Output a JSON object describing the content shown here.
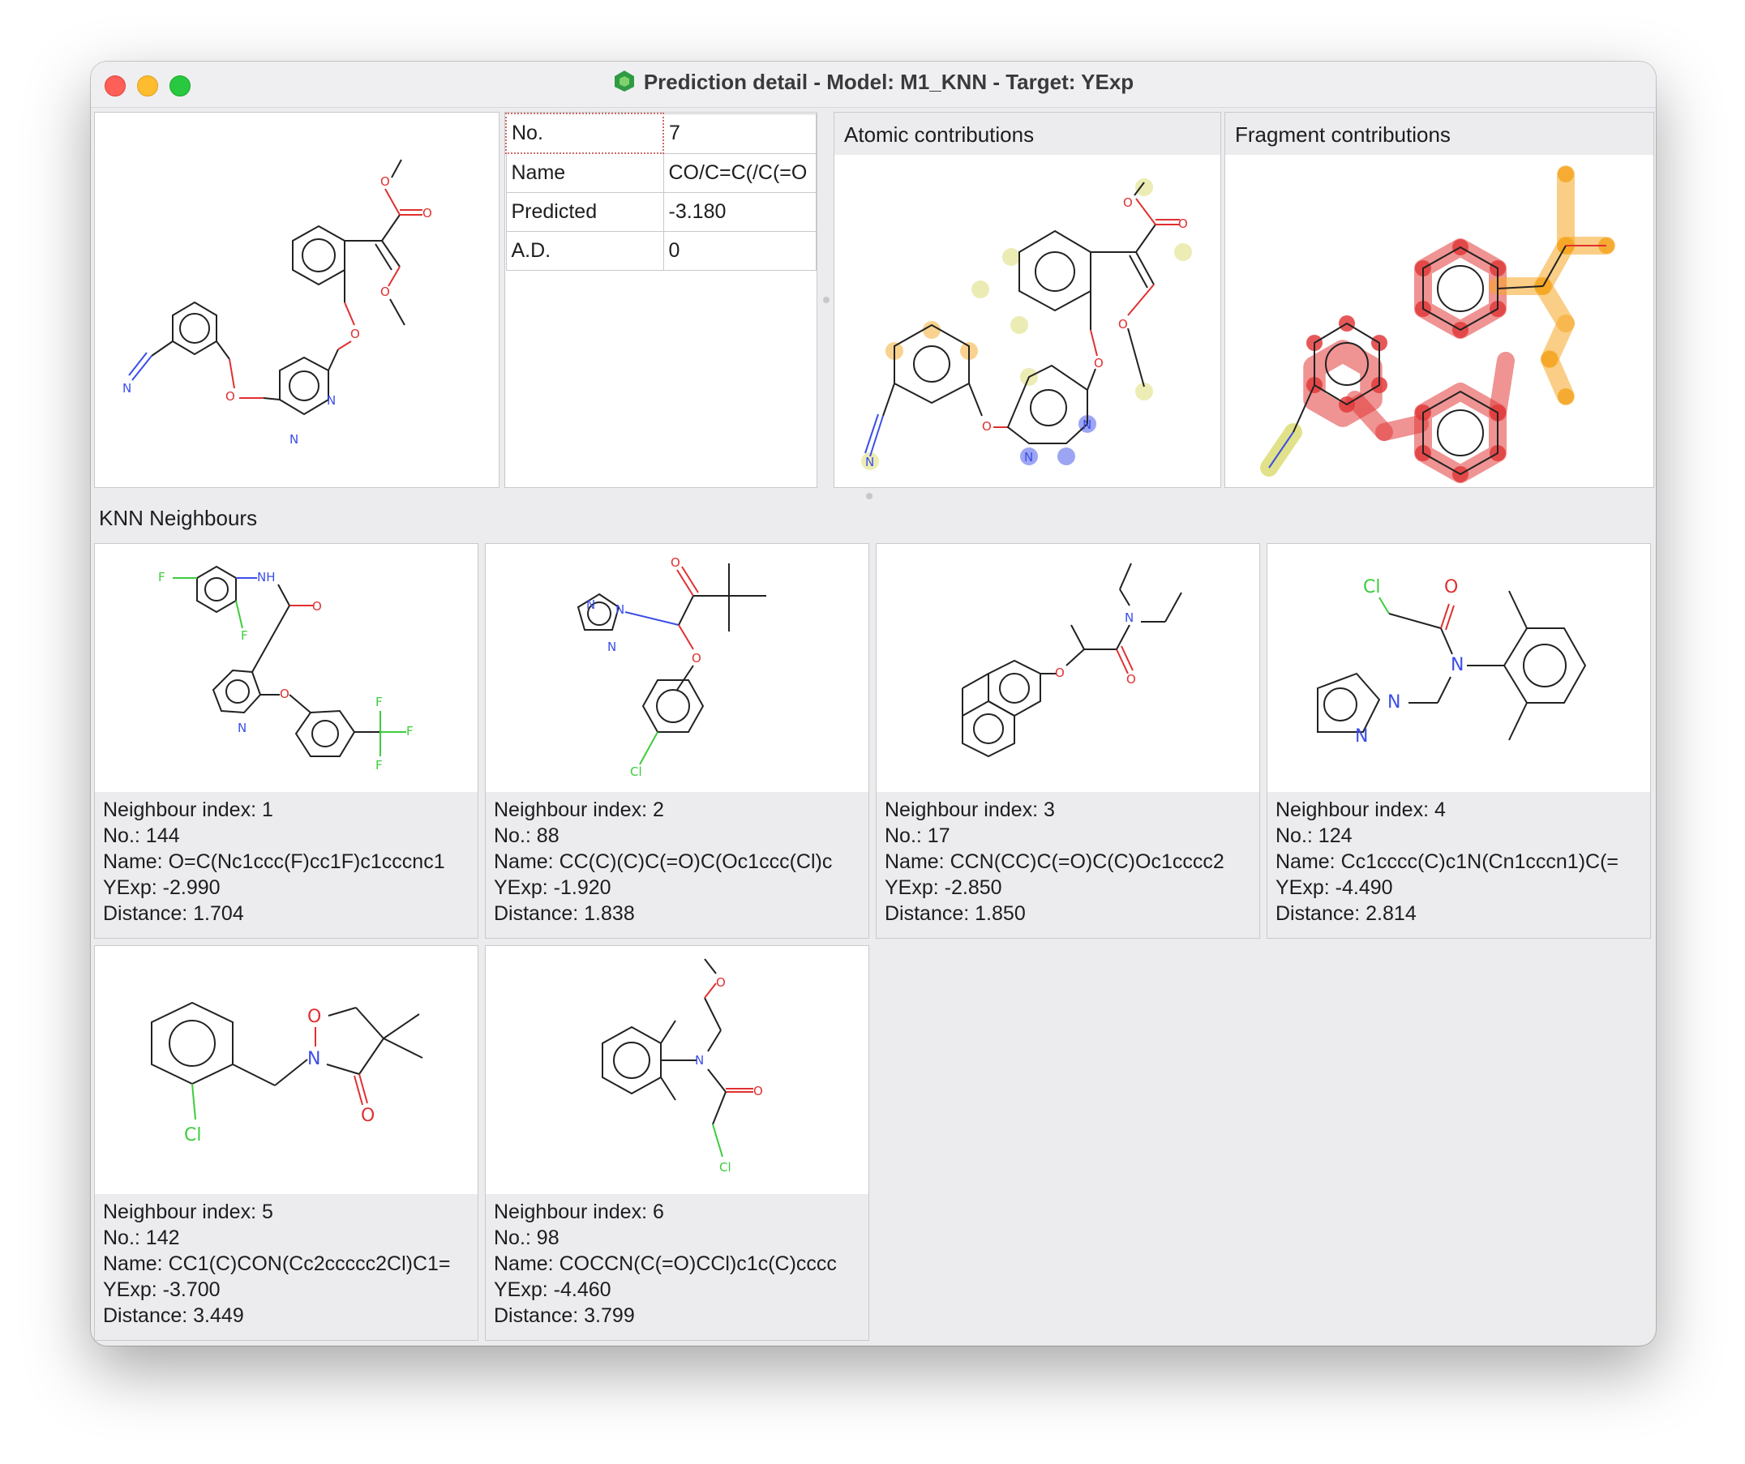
{
  "window": {
    "title": "Prediction detail - Model: M1_KNN - Target: YExp",
    "icon": "app-hexagon-icon"
  },
  "properties": [
    {
      "key": "No.",
      "value": "7"
    },
    {
      "key": "Name",
      "value": "CO/C=C(/C(=O"
    },
    {
      "key": "Predicted",
      "value": "-3.180"
    },
    {
      "key": "A.D.",
      "value": "0"
    }
  ],
  "atomic_panel": {
    "title": "Atomic contributions"
  },
  "fragment_panel": {
    "title": "Fragment contributions"
  },
  "knn_section": {
    "title": "KNN Neighbours"
  },
  "neighbours": [
    {
      "index": "Neighbour index: 1",
      "no": "No.: 144",
      "name": "Name: O=C(Nc1ccc(F)cc1F)c1cccnc1",
      "yexp": "YExp: -2.990",
      "distance": "Distance: 1.704"
    },
    {
      "index": "Neighbour index: 2",
      "no": "No.: 88",
      "name": "Name: CC(C)(C)C(=O)C(Oc1ccc(Cl)c",
      "yexp": "YExp: -1.920",
      "distance": "Distance: 1.838"
    },
    {
      "index": "Neighbour index: 3",
      "no": "No.: 17",
      "name": "Name: CCN(CC)C(=O)C(C)Oc1cccc2",
      "yexp": "YExp: -2.850",
      "distance": "Distance: 1.850"
    },
    {
      "index": "Neighbour index: 4",
      "no": "No.: 124",
      "name": "Name: Cc1cccc(C)c1N(Cn1cccn1)C(=",
      "yexp": "YExp: -4.490",
      "distance": "Distance: 2.814"
    },
    {
      "index": "Neighbour index: 5",
      "no": "No.: 142",
      "name": "Name: CC1(C)CON(Cc2ccccc2Cl)C1=",
      "yexp": "YExp: -3.700",
      "distance": "Distance: 3.449"
    },
    {
      "index": "Neighbour index: 6",
      "no": "No.: 98",
      "name": "Name: COCCN(C(=O)CCl)c1c(C)cccc",
      "yexp": "YExp: -4.460",
      "distance": "Distance: 3.799"
    }
  ],
  "atom_labels": {
    "O": "O",
    "N": "N",
    "Cl": "Cl",
    "F": "F",
    "NH": "NH"
  },
  "colors": {
    "oxygen": "#e03030",
    "nitrogen": "#3b4ee8",
    "halogen": "#3dcc3d",
    "negative_contribution": "#e23b3b",
    "positive_contribution": "#f5a623",
    "neutral_contribution": "#d9d96b"
  }
}
